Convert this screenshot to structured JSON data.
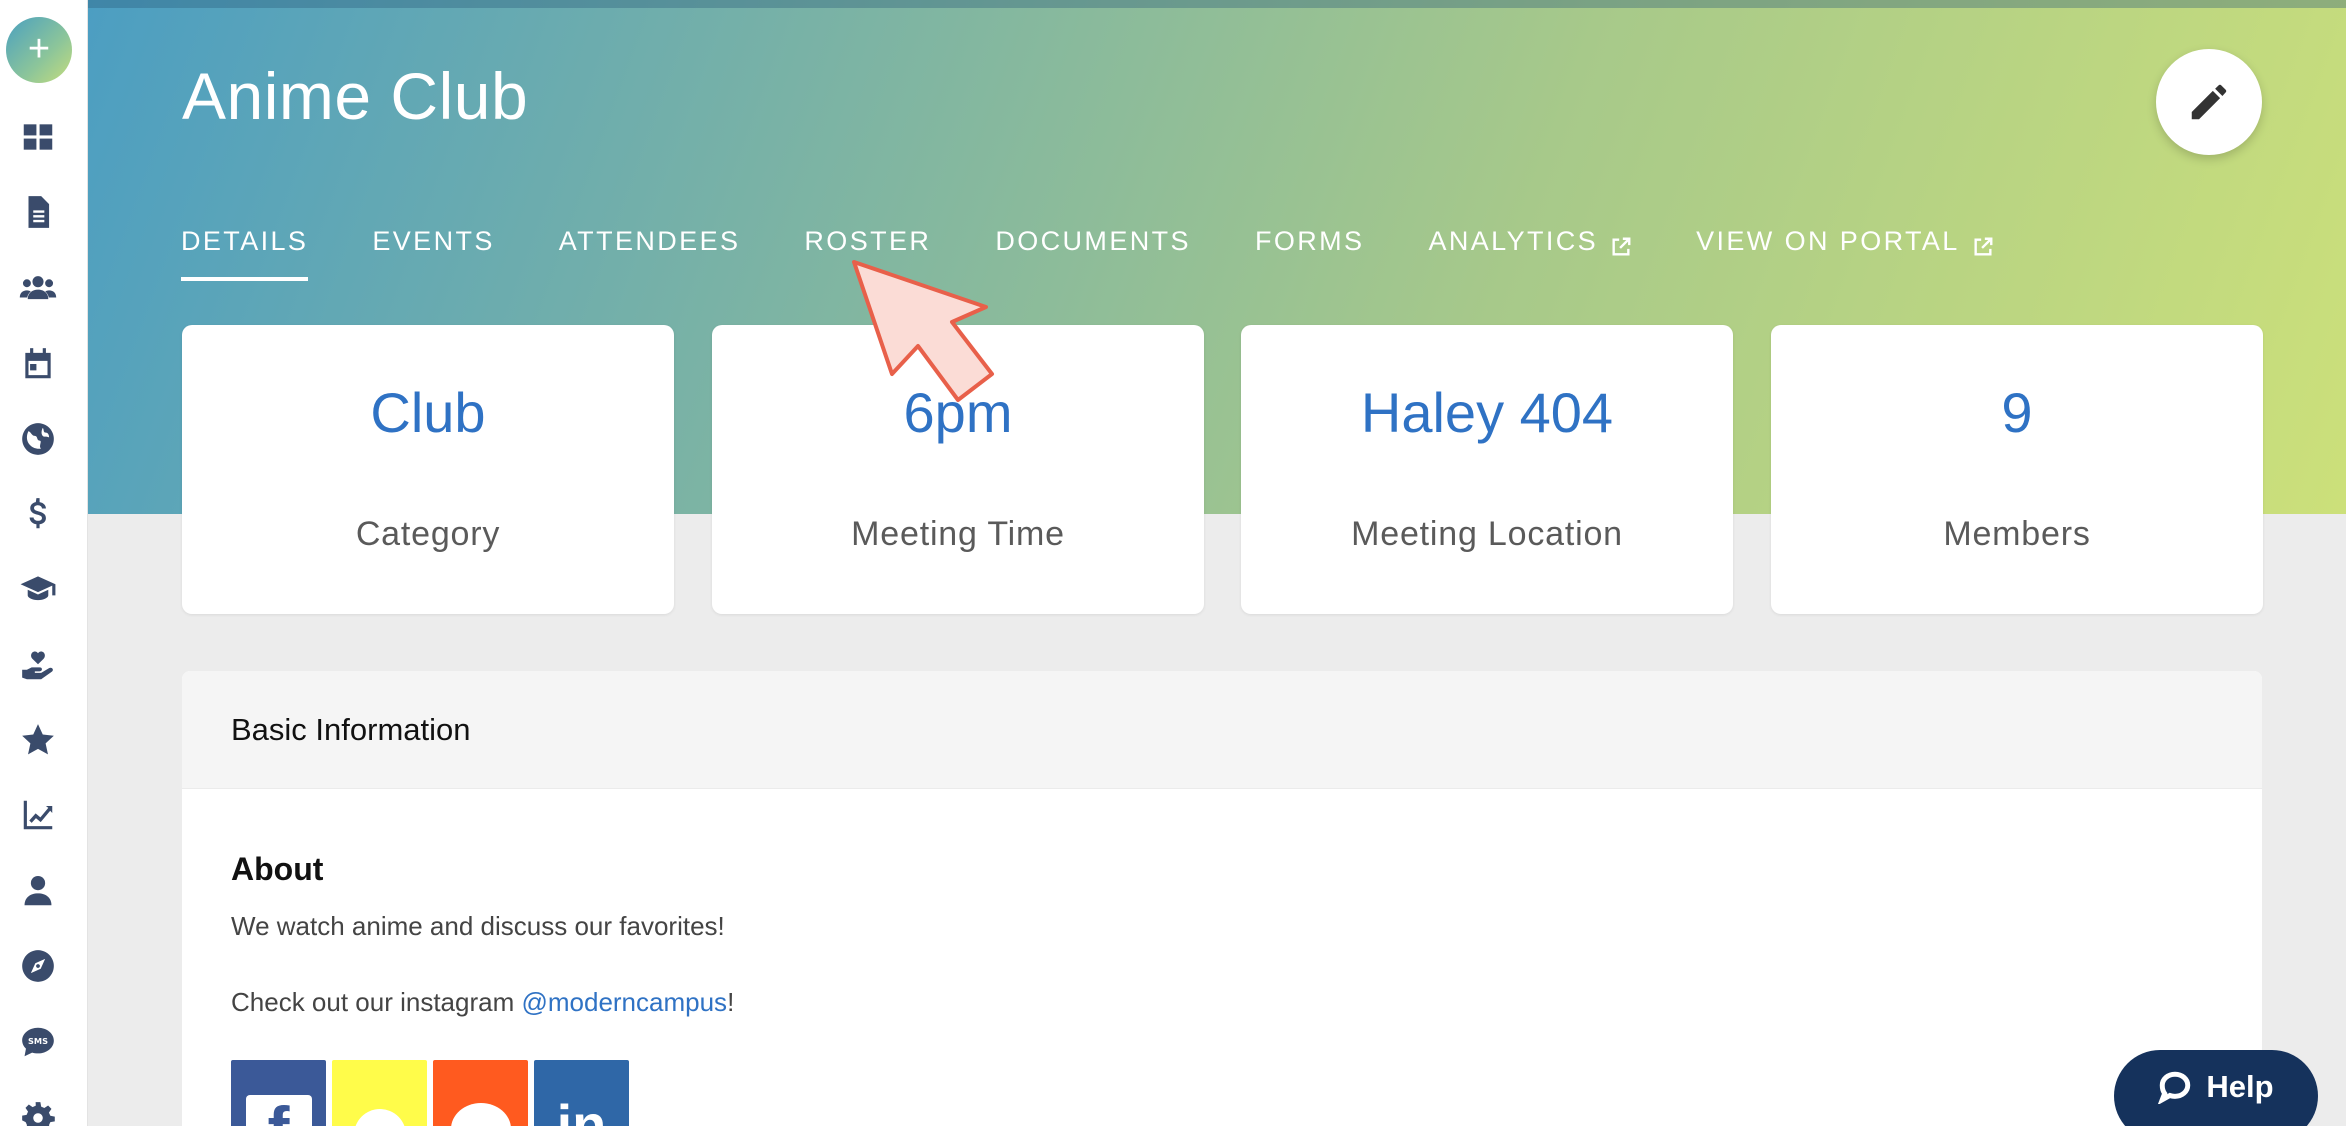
{
  "club": {
    "title": "Anime Club"
  },
  "tabs": [
    {
      "label": "DETAILS",
      "active": true,
      "external": false
    },
    {
      "label": "EVENTS",
      "active": false,
      "external": false
    },
    {
      "label": "ATTENDEES",
      "active": false,
      "external": false
    },
    {
      "label": "ROSTER",
      "active": false,
      "external": false
    },
    {
      "label": "DOCUMENTS",
      "active": false,
      "external": false
    },
    {
      "label": "FORMS",
      "active": false,
      "external": false
    },
    {
      "label": "ANALYTICS",
      "active": false,
      "external": true
    },
    {
      "label": "VIEW ON PORTAL",
      "active": false,
      "external": true
    }
  ],
  "stats": [
    {
      "value": "Club",
      "label": "Category"
    },
    {
      "value": "6pm",
      "label": "Meeting Time"
    },
    {
      "value": "Haley 404",
      "label": "Meeting Location"
    },
    {
      "value": "9",
      "label": "Members"
    }
  ],
  "panel": {
    "header": "Basic Information",
    "about_title": "About",
    "about_text": "We watch anime and discuss our favorites!",
    "insta_prefix": "Check out our instagram ",
    "insta_handle": "@moderncampus",
    "insta_suffix": "!"
  },
  "sidebar": {
    "add_label": "+",
    "icons": [
      "dashboard-icon",
      "document-icon",
      "users-icon",
      "calendar-icon",
      "globe-icon",
      "dollar-icon",
      "graduation-cap-icon",
      "hand-heart-icon",
      "star-icon",
      "chart-line-icon",
      "user-icon",
      "compass-icon",
      "sms-icon",
      "gear-icon"
    ]
  },
  "social": [
    "facebook",
    "snapchat",
    "reddit",
    "linkedin"
  ],
  "help": {
    "label": "Help"
  },
  "colors": {
    "accent": "#2f72c4",
    "sidebar_icon": "#3a4b6b",
    "help_bg": "#15325c"
  }
}
